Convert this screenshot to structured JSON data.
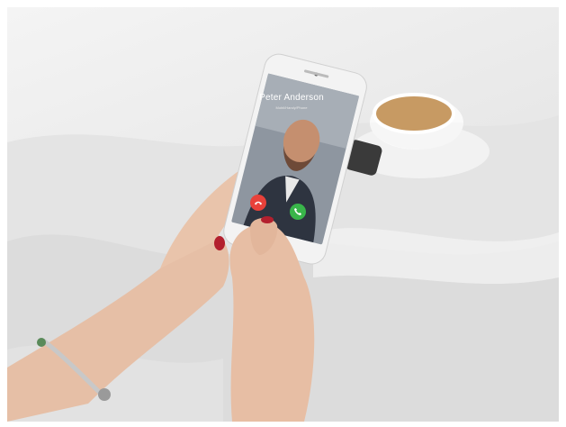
{
  "incoming_call": {
    "caller_name": "Peter Anderson",
    "caller_subtitle": "Mobil/Handy/Phone"
  },
  "icons": {
    "decline": "phone-down-icon",
    "accept": "phone-icon"
  },
  "colors": {
    "decline": "#e8413a",
    "accept": "#39b54a"
  }
}
